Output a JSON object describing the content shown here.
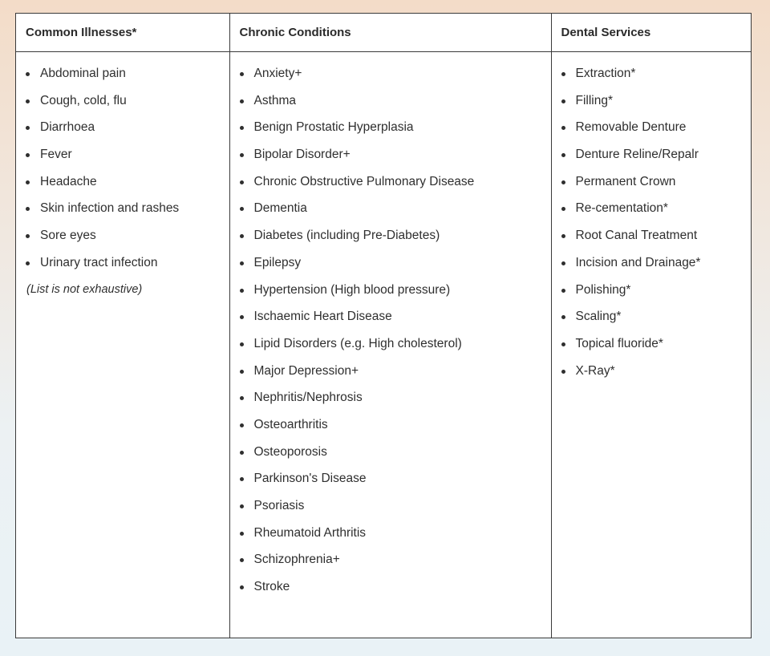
{
  "table": {
    "columns": [
      {
        "header": "Common Illnesses*",
        "items": [
          "Abdominal pain",
          "Cough, cold, flu",
          "Diarrhoea",
          "Fever",
          "Headache",
          "Skin infection and rashes",
          "Sore eyes",
          "Urinary tract infection"
        ],
        "note": "(List is not exhaustive)"
      },
      {
        "header": "Chronic Conditions",
        "items": [
          "Anxiety+",
          "Asthma",
          "Benign Prostatic Hyperplasia",
          "Bipolar Disorder+",
          "Chronic Obstructive Pulmonary Disease",
          "Dementia",
          "Diabetes (including Pre-Diabetes)",
          "Epilepsy",
          "Hypertension (High blood pressure)",
          "Ischaemic Heart Disease",
          "Lipid Disorders (e.g. High cholesterol)",
          "Major Depression+",
          "Nephritis/Nephrosis",
          "Osteoarthritis",
          "Osteoporosis",
          "Parkinson's Disease",
          "Psoriasis",
          "Rheumatoid Arthritis",
          "Schizophrenia+",
          "Stroke"
        ]
      },
      {
        "header": "Dental Services",
        "items": [
          "Extraction*",
          "Filling*",
          "Removable Denture",
          "Denture Reline/Repalr",
          "Permanent Crown",
          "Re-cementation*",
          "Root Canal Treatment",
          "Incision and Drainage*",
          "Polishing*",
          "Scaling*",
          "Topical fluoride*",
          "X-Ray*"
        ]
      }
    ]
  }
}
